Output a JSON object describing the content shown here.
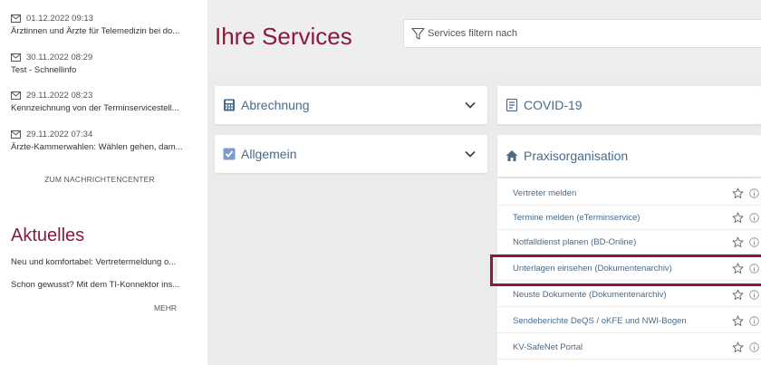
{
  "news": [
    {
      "date": "01.12.2022 09:13",
      "title": "Ärztinnen und Ärzte für Telemedizin bei do..."
    },
    {
      "date": "30.11.2022 08:29",
      "title": "Test - Schnellinfo"
    },
    {
      "date": "29.11.2022 08:23",
      "title": "Kennzeichnung von der Terminservicestell..."
    },
    {
      "date": "29.11.2022 07:34",
      "title": "Ärzte-Kammerwahlen: Wählen gehen, dam..."
    }
  ],
  "news_center_link": "ZUM NACHRICHTENCENTER",
  "aktuelles": {
    "heading": "Aktuelles",
    "items": [
      "Neu und komfortabel: Vertretermeldung o...",
      "Schon gewusst? Mit dem TI-Konnektor ins..."
    ],
    "more_link": "MEHR"
  },
  "main": {
    "title": "Ihre Services",
    "filter_placeholder": "Services filtern nach"
  },
  "cards": {
    "abrechnung": "Abrechnung",
    "covid": "COVID-19",
    "allgemein": "Allgemein",
    "praxis": "Praxisorganisation"
  },
  "services": [
    "Vertreter melden",
    "Termine melden (eTerminservice)",
    "Notfalldienst planen (BD-Online)",
    "Unterlagen einsehen (Dokumentenarchiv)",
    "Neuste Dokumente (Dokumentenarchiv)",
    "Sendeberichte DeQS / oKFE und NWI-Bogen",
    "KV-SafeNet Portal"
  ],
  "highlighted_service_index": 3,
  "colors": {
    "accent": "#8b1a3a",
    "link": "#4a6a8a",
    "background": "#ebebeb"
  }
}
